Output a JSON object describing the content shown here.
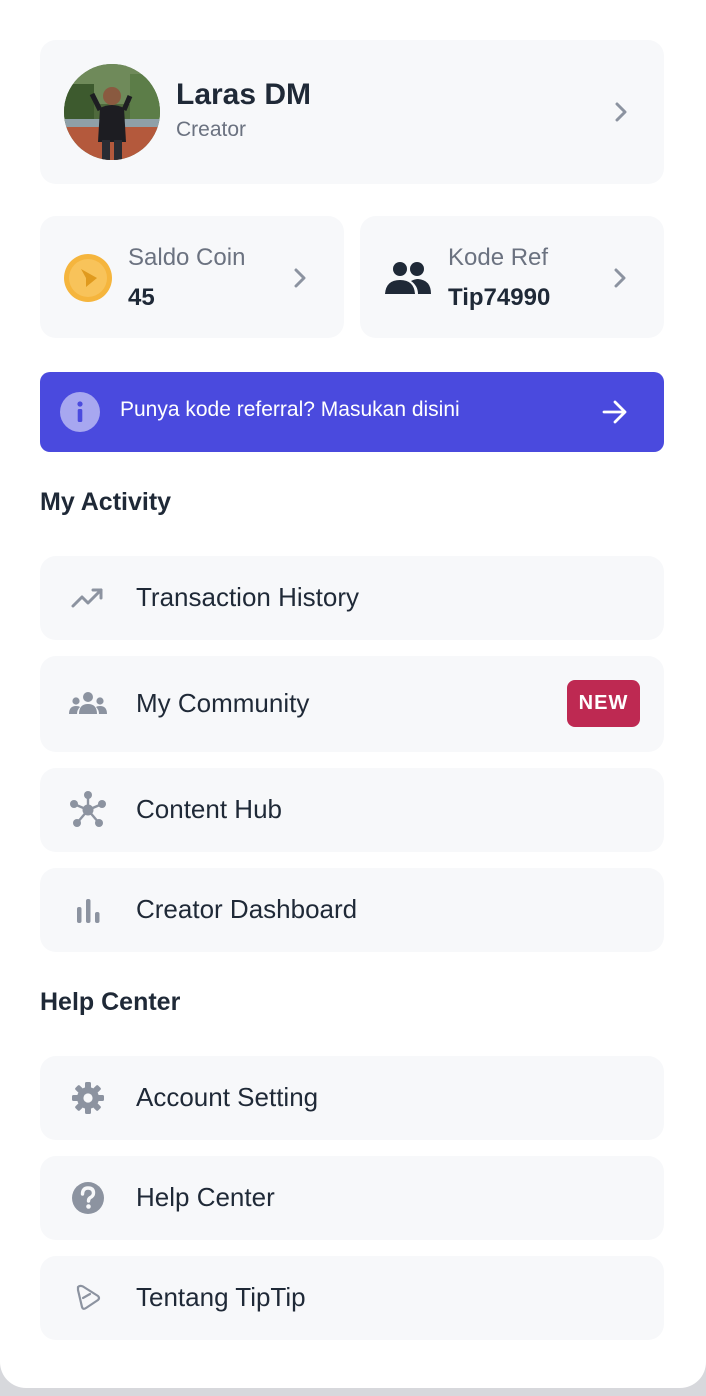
{
  "profile": {
    "name": "Laras DM",
    "role": "Creator"
  },
  "stats": {
    "coin": {
      "label": "Saldo Coin",
      "value": "45"
    },
    "referral": {
      "label": "Kode Ref",
      "value": "Tip74990"
    }
  },
  "banner": {
    "text": "Punya kode referral? Masukan disini"
  },
  "sections": {
    "activity": {
      "title": "My Activity",
      "items": [
        {
          "label": "Transaction History",
          "icon": "trending-up-icon"
        },
        {
          "label": "My Community",
          "icon": "group-icon",
          "badge": "NEW"
        },
        {
          "label": "Content Hub",
          "icon": "hub-icon"
        },
        {
          "label": "Creator Dashboard",
          "icon": "bar-chart-icon"
        }
      ]
    },
    "help": {
      "title": "Help Center",
      "items": [
        {
          "label": "Account Setting",
          "icon": "gear-icon"
        },
        {
          "label": "Help Center",
          "icon": "help-circle-icon"
        },
        {
          "label": "Tentang TipTip",
          "icon": "tiptip-logo-icon"
        }
      ]
    }
  },
  "colors": {
    "accent": "#4a4ade",
    "badge": "#be2952",
    "card": "#f7f8fa",
    "muted_icon": "#8c93a0"
  }
}
